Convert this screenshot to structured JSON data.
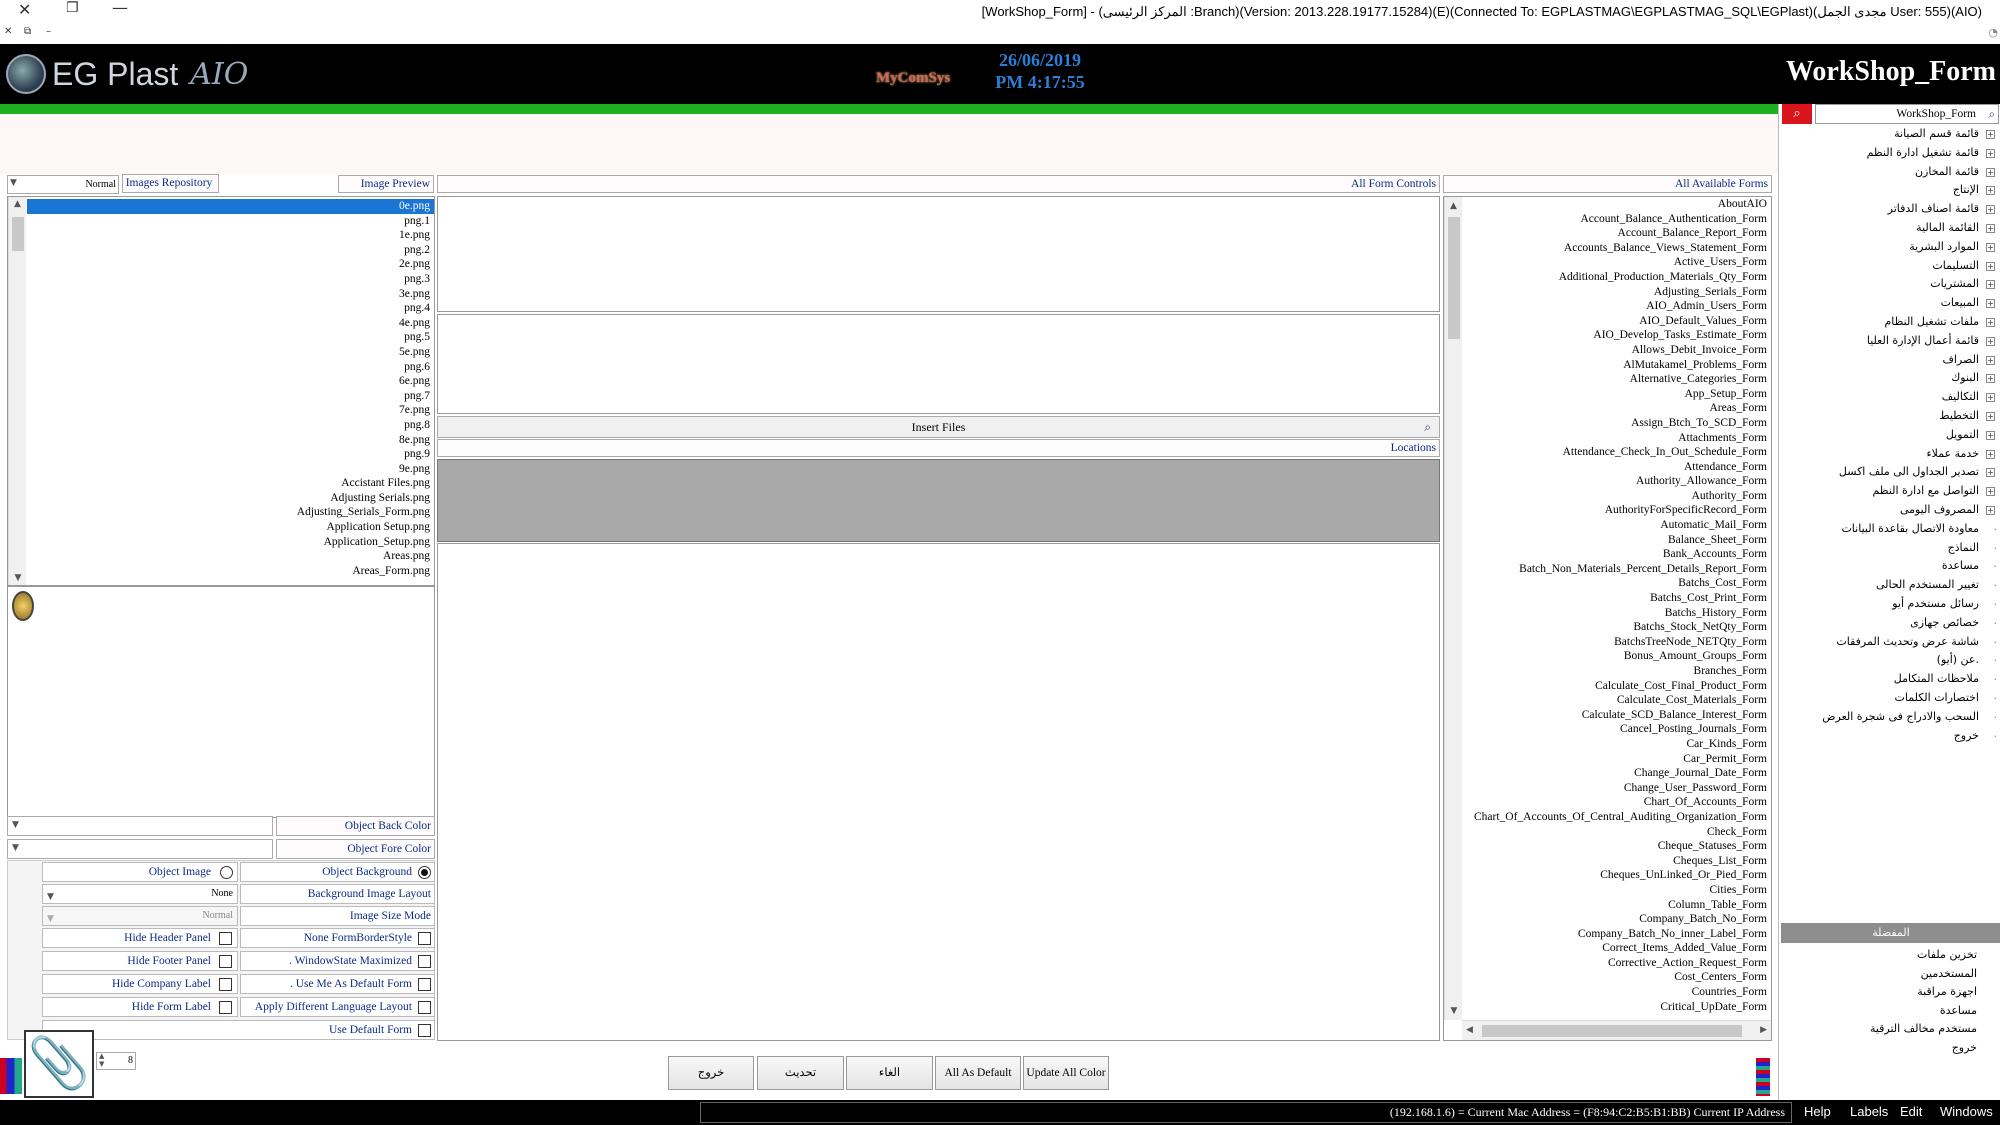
{
  "window": {
    "title": "[WorkShop_Form] - (المركز الرئيسى :Branch)(Version: 2013.228.19177.15284)(E)(Connected To: EGPLASTMAG\\EGPLASTMAG_SQL\\EGPlast)(مجدى الجمل User: 555)(AIO)"
  },
  "header": {
    "logo_text": "EG Plast",
    "logo_aio": "AIO",
    "mcs": "MyComSys",
    "date": "26/06/2019",
    "time": "PM 4:17:55",
    "form_name": "WorkShop_Form"
  },
  "left_panel": {
    "size_mode_value": "Normal",
    "images_repository_label": "Images Repository",
    "image_preview_label": "Image Preview",
    "images": [
      "0e.png",
      "png.1",
      "1e.png",
      "png.2",
      "2e.png",
      "png.3",
      "3e.png",
      "png.4",
      "4e.png",
      "png.5",
      "5e.png",
      "png.6",
      "6e.png",
      "png.7",
      "7e.png",
      "png.8",
      "8e.png",
      "png.9",
      "9e.png",
      "Accistant Files.png",
      "Adjusting Serials.png",
      "Adjusting_Serials_Form.png",
      "Application Setup.png",
      "Application_Setup.png",
      "Areas.png",
      "Areas_Form.png"
    ],
    "object_back_color": "Object Back Color",
    "object_fore_color": "Object Fore Color",
    "object_image": "Object Image",
    "object_background": "Object Background",
    "background_layout_value": "None",
    "background_layout_label": "Background Image Layout",
    "image_size_mode_value": "Normal",
    "image_size_mode_label": "Image  Size Mode",
    "hide_header_panel": "Hide Header Panel",
    "none_border_style": "None FormBorderStyle",
    "hide_footer_panel": "Hide Footer Panel",
    "window_state_maximized": ". WindowState Maximized",
    "hide_company_label": "Hide Company Label",
    "use_me_default": ". Use Me As Default Form",
    "hide_form_label": "Hide Form Label",
    "apply_language_layout": "Apply Different Language Layout",
    "use_default_form": "Use Default Form",
    "stepper_value": "8"
  },
  "center_panel": {
    "all_form_controls": "All Form Controls",
    "insert_files": "Insert Files",
    "locations": "Locations"
  },
  "forms_panel": {
    "label": "All Available Forms",
    "forms": [
      "AboutAIO",
      "Account_Balance_Authentication_Form",
      "Account_Balance_Report_Form",
      "Accounts_Balance_Views_Statement_Form",
      "Active_Users_Form",
      "Additional_Production_Materials_Qty_Form",
      "Adjusting_Serials_Form",
      "AIO_Admin_Users_Form",
      "AIO_Default_Values_Form",
      "AIO_Develop_Tasks_Estimate_Form",
      "Allows_Debit_Invoice_Form",
      "AlMutakamel_Problems_Form",
      "Alternative_Categories_Form",
      "App_Setup_Form",
      "Areas_Form",
      "Assign_Btch_To_SCD_Form",
      "Attachments_Form",
      "Attendance_Check_In_Out_Schedule_Form",
      "Attendance_Form",
      "Authority_Allowance_Form",
      "Authority_Form",
      "AuthorityForSpecificRecord_Form",
      "Automatic_Mail_Form",
      "Balance_Sheet_Form",
      "Bank_Accounts_Form",
      "Batch_Non_Materials_Percent_Details_Report_Form",
      "Batchs_Cost_Form",
      "Batchs_Cost_Print_Form",
      "Batchs_History_Form",
      "Batchs_Stock_NetQty_Form",
      "BatchsTreeNode_NETQty_Form",
      "Bonus_Amount_Groups_Form",
      "Branches_Form",
      "Calculate_Cost_Final_Product_Form",
      "Calculate_Cost_Materials_Form",
      "Calculate_SCD_Balance_Interest_Form",
      "Cancel_Posting_Journals_Form",
      "Car_Kinds_Form",
      "Car_Permit_Form",
      "Change_Journal_Date_Form",
      "Change_User_Password_Form",
      "Chart_Of_Accounts_Form",
      "Chart_Of_Accounts_Of_Central_Auditing_Organization_Form",
      "Check_Form",
      "Cheque_Statuses_Form",
      "Cheques_List_Form",
      "Cheques_UnLinked_Or_Pied_Form",
      "Cities_Form",
      "Column_Table_Form",
      "Company_Batch_No_Form",
      "Company_Batch_No_inner_Label_Form",
      "Correct_Items_Added_Value_Form",
      "Corrective_Action_Request_Form",
      "Cost_Centers_Form",
      "Countries_Form",
      "Critical_UpDate_Form"
    ]
  },
  "buttons": {
    "exit": "خروج",
    "update": "تحديث",
    "cancel": "الغاء",
    "all_as_default": "All As Default",
    "update_all_color": "Update All Color"
  },
  "sidebar": {
    "search_value": "WorkShop_Form",
    "tree": [
      {
        "label": "قائمة قسم الصيانة",
        "expandable": true
      },
      {
        "label": "قائمة تشغيل ادارة النظم",
        "expandable": true
      },
      {
        "label": "قائمة المخازن",
        "expandable": true
      },
      {
        "label": "الإنتاج",
        "expandable": true
      },
      {
        "label": "قائمة اصناف الدفاتر",
        "expandable": true
      },
      {
        "label": "القائمة المالية",
        "expandable": true
      },
      {
        "label": "الموارد البشرية",
        "expandable": true
      },
      {
        "label": "التسليمات",
        "expandable": true
      },
      {
        "label": "المشتريات",
        "expandable": true
      },
      {
        "label": "المبيعات",
        "expandable": true
      },
      {
        "label": "ملفات تشغيل النظام",
        "expandable": true
      },
      {
        "label": "قائمة أعمال الإدارة العليا",
        "expandable": true
      },
      {
        "label": "الصراف",
        "expandable": true
      },
      {
        "label": "البنوك",
        "expandable": true
      },
      {
        "label": "التكاليف",
        "expandable": true
      },
      {
        "label": "التخطيط",
        "expandable": true
      },
      {
        "label": "التمويل",
        "expandable": true
      },
      {
        "label": "خدمة عملاء",
        "expandable": true
      },
      {
        "label": "تصدير الجداول الى ملف اكسل",
        "expandable": true
      },
      {
        "label": "التواصل مع ادارة النظم",
        "expandable": true
      },
      {
        "label": "المصروف اليومى",
        "expandable": true
      },
      {
        "label": "معاودة الاتصال بقاعدة البيانات",
        "expandable": false
      },
      {
        "label": "النماذج",
        "expandable": false
      },
      {
        "label": "مساعدة",
        "expandable": false
      },
      {
        "label": "تغيير المستخدم الحالى",
        "expandable": false
      },
      {
        "label": "رسائل مستخدم أيو",
        "expandable": false
      },
      {
        "label": "خصائص جهازى",
        "expandable": false
      },
      {
        "label": "شاشة عرض وتحديث المرفقات",
        "expandable": false
      },
      {
        "label": "عن (أيو).",
        "expandable": false
      },
      {
        "label": "ملاحظات المتكامل",
        "expandable": false
      },
      {
        "label": "اختصارات الكلمات",
        "expandable": false
      },
      {
        "label": "السحب والادراج فى شجرة العرض",
        "expandable": false
      },
      {
        "label": "خروج",
        "expandable": false
      }
    ],
    "favorites_title": "المفضلة",
    "favorites": [
      "تخزين ملفات",
      "المستخدمين",
      "اجهزة مراقبة",
      "مساعدة",
      "مستخدم مخالف الترقية",
      "خروج"
    ]
  },
  "status": {
    "ip_text": "(192.168.1.6) = Current Mac Address = (F8:94:C2:B5:B1:BB) Current IP Address",
    "menu": [
      "Help",
      "Labels",
      "Edit",
      "Windows"
    ]
  }
}
